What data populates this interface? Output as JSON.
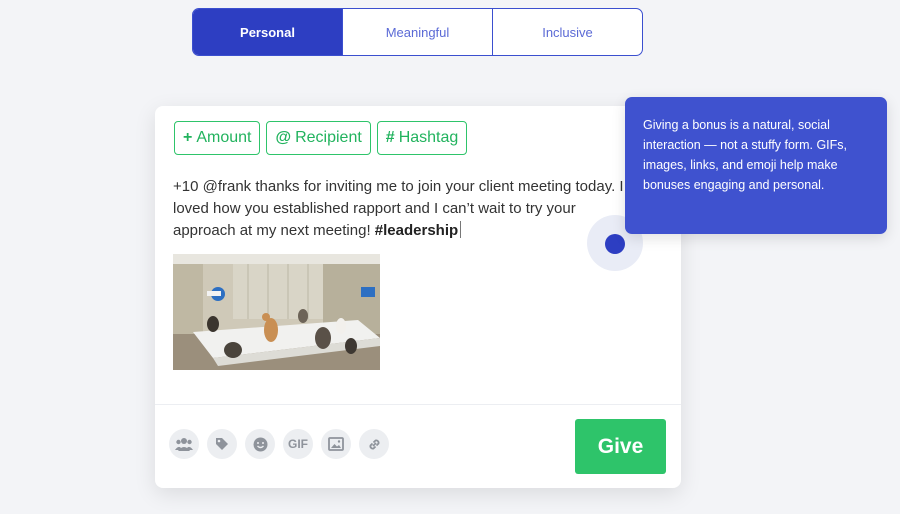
{
  "tabs": [
    {
      "label": "Personal",
      "active": true
    },
    {
      "label": "Meaningful",
      "active": false
    },
    {
      "label": "Inclusive",
      "active": false
    }
  ],
  "chips": [
    {
      "symbol": "+",
      "label": "Amount"
    },
    {
      "symbol": "@",
      "label": "Recipient"
    },
    {
      "symbol": "#",
      "label": "Hashtag"
    }
  ],
  "message": {
    "line1": "+10 @frank thanks for inviting me to join your client meeting today. I",
    "line2": "loved how you established rapport and I can’t wait to try your",
    "line3_text": "approach at my next meeting! ",
    "line3_hashtag": "#leadership"
  },
  "toolbar": {
    "gif_label": "GIF",
    "icons": [
      "people-icon",
      "tag-icon",
      "emoji-icon",
      "gif-icon",
      "image-icon",
      "link-icon"
    ]
  },
  "give_label": "Give",
  "tooltip": {
    "text": "Giving a bonus is a natural, social interaction — not a stuffy form. GIFs, images, links, and emoji help make bonuses engaging and personal."
  },
  "colors": {
    "primary": "#2d3ec2",
    "tooltip_bg": "#3f52cf",
    "green": "#2ec46a",
    "background": "#f3f4f7"
  }
}
